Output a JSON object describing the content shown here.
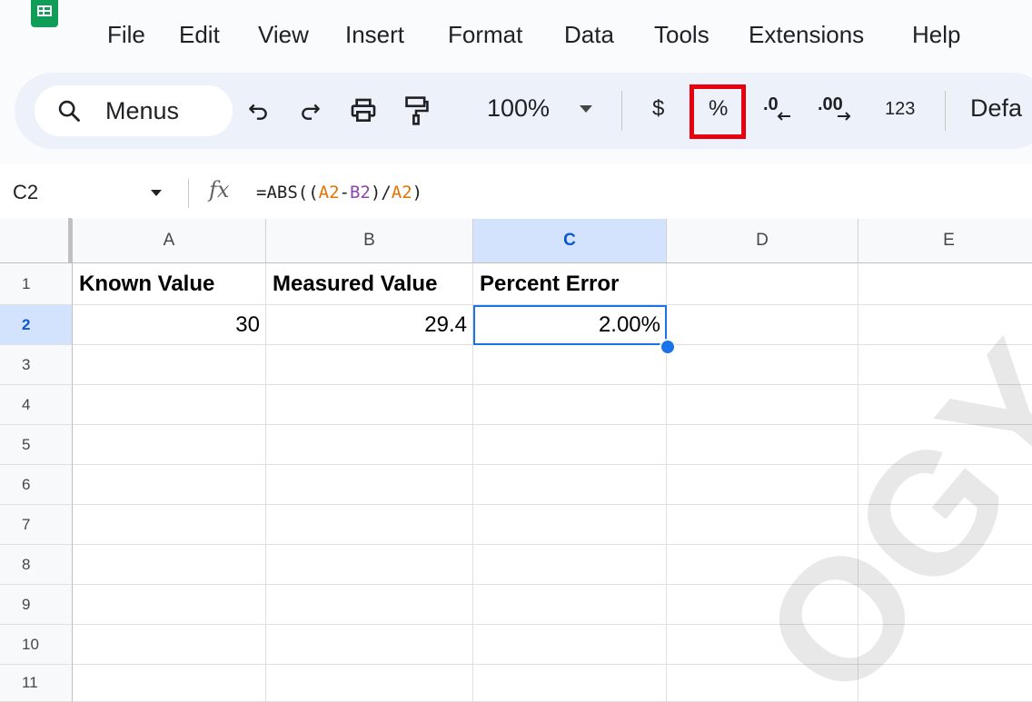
{
  "menubar": {
    "items": [
      "File",
      "Edit",
      "View",
      "Insert",
      "Format",
      "Data",
      "Tools",
      "Extensions",
      "Help"
    ]
  },
  "toolbar": {
    "search_label": "Menus",
    "zoom": "100%",
    "currency": "$",
    "percent": "%",
    "decrease_decimal": ".0",
    "increase_decimal": ".00",
    "more_formats": "123",
    "font": "Defa",
    "highlight_color": "#e8000f"
  },
  "formula_bar": {
    "name_box": "C2",
    "fx": "fx",
    "formula_parts": [
      "=ABS((",
      "A2",
      "-",
      "B2",
      ")/",
      "A2",
      ")"
    ]
  },
  "grid": {
    "columns": [
      "A",
      "B",
      "C",
      "D",
      "E"
    ],
    "rows": [
      "1",
      "2",
      "3",
      "4",
      "5",
      "6",
      "7",
      "8",
      "9",
      "10",
      "11"
    ],
    "cells": {
      "A1": "Known Value",
      "B1": "Measured Value",
      "C1": "Percent Error",
      "A2": "30",
      "B2": "29.4",
      "C2": "2.00%"
    },
    "selected_cell": "C2"
  },
  "watermark": {
    "text": "OGY.COM"
  }
}
